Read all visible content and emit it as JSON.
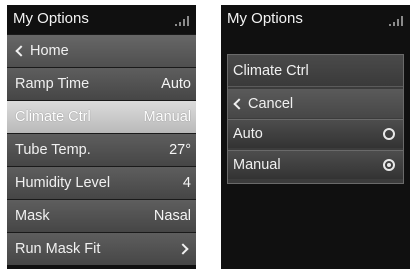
{
  "left_screen": {
    "title": "My Options",
    "signal_icon": "signal-bars-icon",
    "items": [
      {
        "label": "Home",
        "value": ""
      },
      {
        "label": "Ramp Time",
        "value": "Auto"
      },
      {
        "label": "Climate Ctrl",
        "value": "Manual"
      },
      {
        "label": "Tube Temp.",
        "value": "27°"
      },
      {
        "label": "Humidity Level",
        "value": "4"
      },
      {
        "label": "Mask",
        "value": "Nasal"
      },
      {
        "label": "Run Mask Fit",
        "value": ""
      }
    ]
  },
  "right_screen": {
    "title": "My Options",
    "signal_icon": "signal-bars-icon",
    "panel_title": "Climate Ctrl",
    "cancel_label": "Cancel",
    "options": [
      {
        "label": "Auto",
        "selected": false
      },
      {
        "label": "Manual",
        "selected": true
      }
    ]
  }
}
